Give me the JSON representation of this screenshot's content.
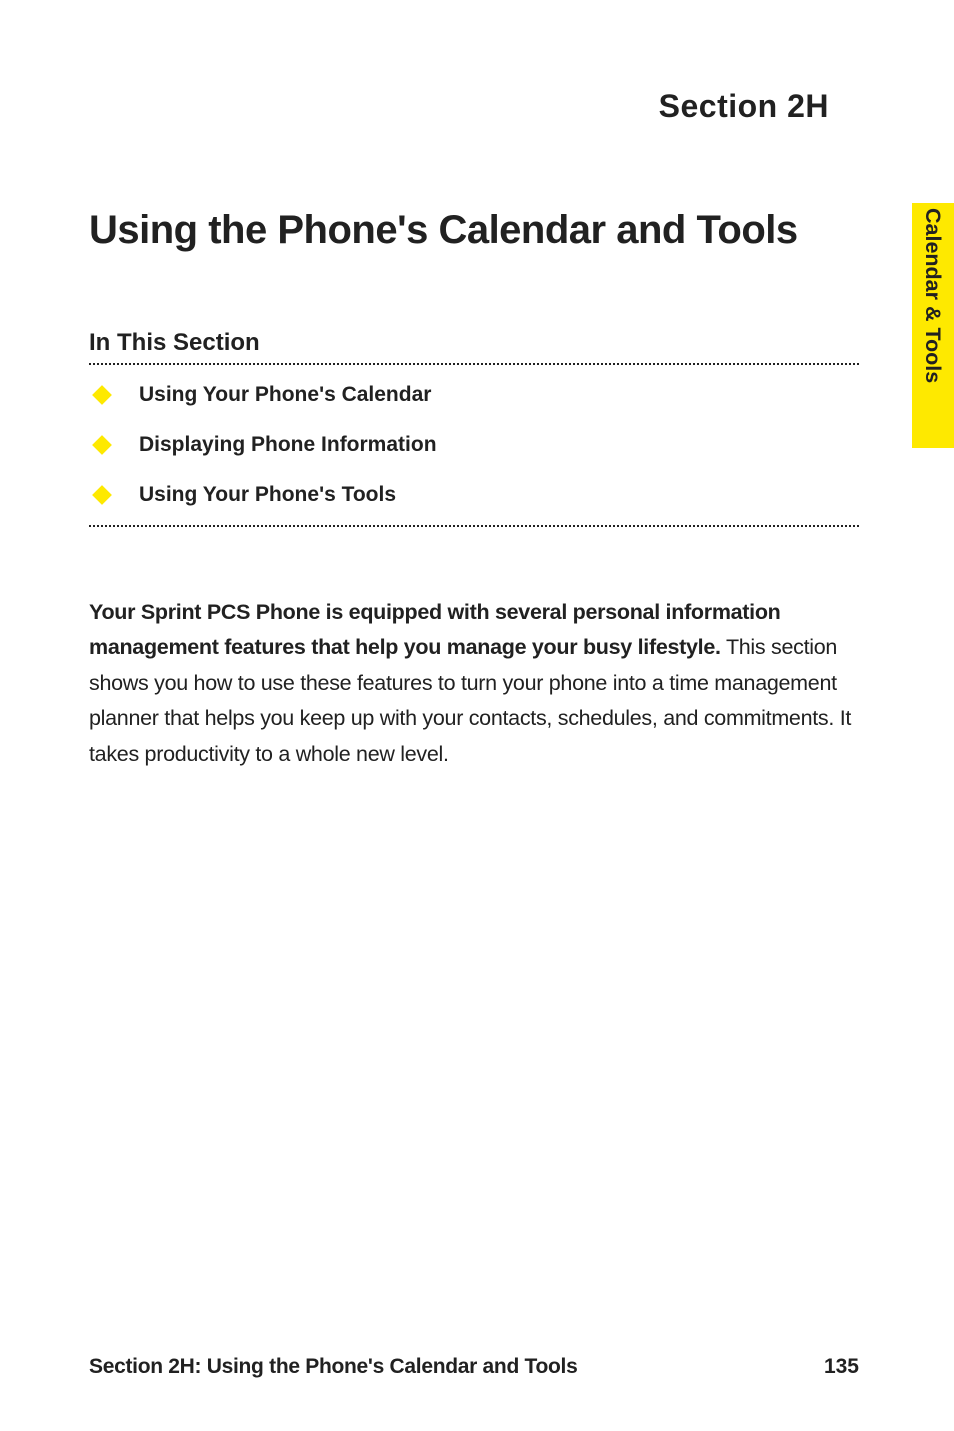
{
  "section_label": "Section 2H",
  "main_title": "Using the Phone's Calendar and Tools",
  "subsection_title": "In This Section",
  "side_tab": "Calendar & Tools",
  "bullets": {
    "item0": "Using Your Phone's Calendar",
    "item1": "Displaying Phone Information",
    "item2": "Using Your Phone's Tools"
  },
  "body": {
    "bold_intro": "Your Sprint PCS Phone is equipped with several personal information management features that help you manage your busy lifestyle.",
    "rest": " This section shows you how to use these features to turn your phone into a time management planner that helps you keep up with your contacts, schedules, and commitments. It takes productivity to a whole new level."
  },
  "footer": {
    "left": "Section 2H: Using the Phone's Calendar and Tools",
    "page": "135"
  }
}
